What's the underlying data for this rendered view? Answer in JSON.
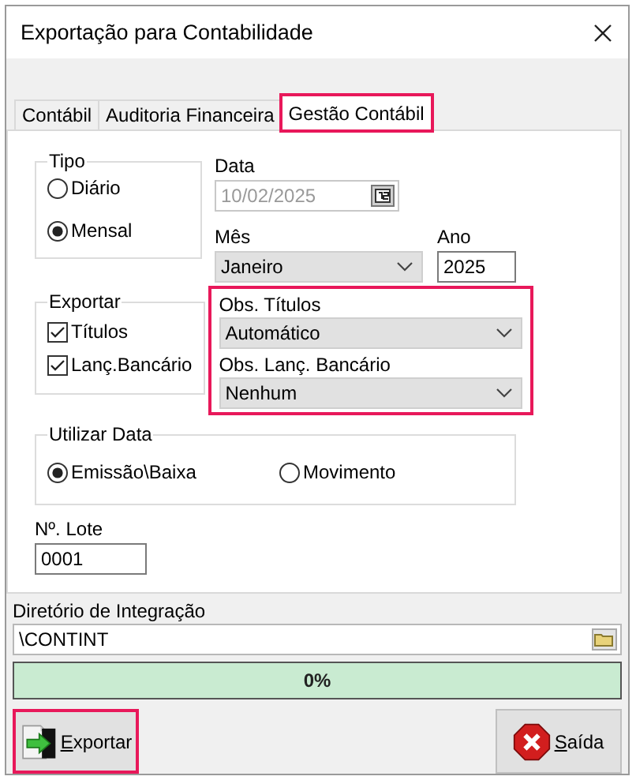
{
  "window": {
    "title": "Exportação para Contabilidade"
  },
  "tabs": [
    {
      "label": "Contábil",
      "selected": false,
      "highlighted": false
    },
    {
      "label": "Auditoria Financeira",
      "selected": false,
      "highlighted": false
    },
    {
      "label": "Gestão Contábil",
      "selected": true,
      "highlighted": true
    }
  ],
  "tipo": {
    "label": "Tipo",
    "options": [
      {
        "label": "Diário",
        "selected": false
      },
      {
        "label": "Mensal",
        "selected": true
      }
    ]
  },
  "data": {
    "label": "Data",
    "value": "10/02/2025",
    "disabled": true
  },
  "mes": {
    "label": "Mês",
    "value": "Janeiro"
  },
  "ano": {
    "label": "Ano",
    "value": "2025"
  },
  "exportar": {
    "label": "Exportar",
    "options": [
      {
        "label": "Títulos",
        "checked": true
      },
      {
        "label": "Lanç.Bancário",
        "checked": true
      }
    ]
  },
  "obs": {
    "highlighted": true,
    "fields": [
      {
        "label": "Obs. Títulos",
        "value": "Automático"
      },
      {
        "label": "Obs. Lanç. Bancário",
        "value": "Nenhum"
      }
    ]
  },
  "utilizar_data": {
    "label": "Utilizar Data",
    "options": [
      {
        "label": "Emissão\\Baixa",
        "selected": true
      },
      {
        "label": "Movimento",
        "selected": false
      }
    ]
  },
  "lote": {
    "label": "Nº. Lote",
    "value": "0001"
  },
  "diretorio": {
    "label": "Diretório de Integração",
    "value": "\\CONTINT"
  },
  "progress": {
    "level": 0,
    "reading": "0%"
  },
  "buttons": [
    {
      "kind": "export",
      "label": "Exportar",
      "highlighted": true
    },
    {
      "kind": "exit",
      "label": "Saída",
      "highlighted": false
    }
  ]
}
